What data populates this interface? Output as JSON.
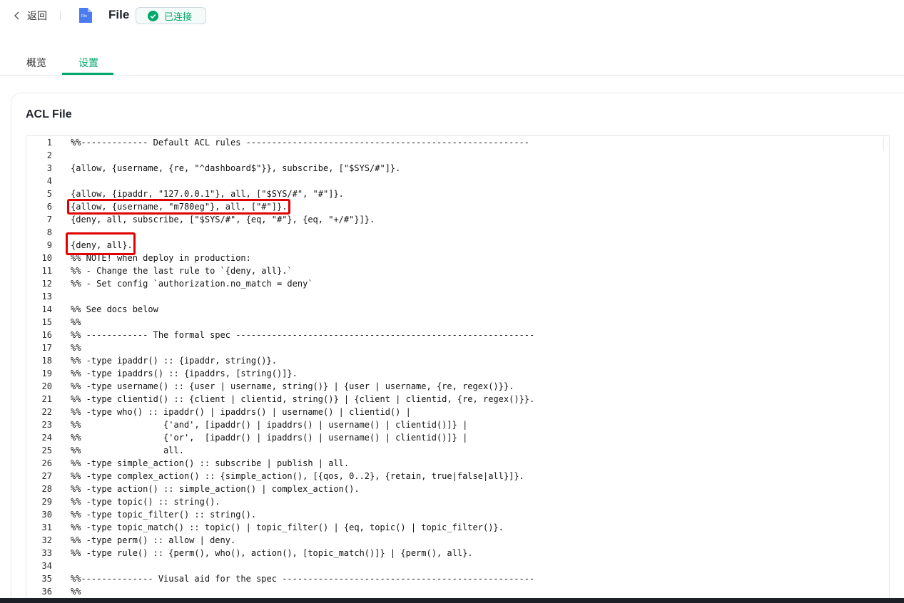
{
  "header": {
    "back_label": "返回",
    "title": "File",
    "status": "已连接",
    "file_icon_text": "File"
  },
  "tabs": [
    {
      "label": "概览",
      "active": false
    },
    {
      "label": "设置",
      "active": true
    }
  ],
  "card": {
    "title": "ACL File"
  },
  "editor": {
    "lines": [
      {
        "n": "1",
        "text": "%%------------- Default ACL rules -------------------------------------------------------"
      },
      {
        "n": "2",
        "text": ""
      },
      {
        "n": "3",
        "text": "{allow, {username, {re, \"^dashboard$\"}}, subscribe, [\"$SYS/#\"]}."
      },
      {
        "n": "4",
        "text": ""
      },
      {
        "n": "5",
        "text": "{allow, {ipaddr, \"127.0.0.1\"}, all, [\"$SYS/#\", \"#\"]}."
      },
      {
        "n": "6",
        "text": "{allow, {username, \"m780eg\"}, all, [\"#\"]}."
      },
      {
        "n": "7",
        "text": "{deny, all, subscribe, [\"$SYS/#\", {eq, \"#\"}, {eq, \"+/#\"}]}."
      },
      {
        "n": "8",
        "text": ""
      },
      {
        "n": "9",
        "text": "{deny, all}."
      },
      {
        "n": "10",
        "text": "%% NOTE! when deploy in production:"
      },
      {
        "n": "11",
        "text": "%% - Change the last rule to `{deny, all}.`"
      },
      {
        "n": "12",
        "text": "%% - Set config `authorization.no_match = deny`"
      },
      {
        "n": "13",
        "text": ""
      },
      {
        "n": "14",
        "text": "%% See docs below"
      },
      {
        "n": "15",
        "text": "%%"
      },
      {
        "n": "16",
        "text": "%% ------------ The formal spec ----------------------------------------------------------"
      },
      {
        "n": "17",
        "text": "%%"
      },
      {
        "n": "18",
        "text": "%% -type ipaddr() :: {ipaddr, string()}."
      },
      {
        "n": "19",
        "text": "%% -type ipaddrs() :: {ipaddrs, [string()]}."
      },
      {
        "n": "20",
        "text": "%% -type username() :: {user | username, string()} | {user | username, {re, regex()}}."
      },
      {
        "n": "21",
        "text": "%% -type clientid() :: {client | clientid, string()} | {client | clientid, {re, regex()}}."
      },
      {
        "n": "22",
        "text": "%% -type who() :: ipaddr() | ipaddrs() | username() | clientid() |"
      },
      {
        "n": "23",
        "text": "%%                {'and', [ipaddr() | ipaddrs() | username() | clientid()]} |"
      },
      {
        "n": "24",
        "text": "%%                {'or',  [ipaddr() | ipaddrs() | username() | clientid()]} |"
      },
      {
        "n": "25",
        "text": "%%                all."
      },
      {
        "n": "26",
        "text": "%% -type simple_action() :: subscribe | publish | all."
      },
      {
        "n": "27",
        "text": "%% -type complex_action() :: {simple_action(), [{qos, 0..2}, {retain, true|false|all}]}."
      },
      {
        "n": "28",
        "text": "%% -type action() :: simple_action() | complex_action()."
      },
      {
        "n": "29",
        "text": "%% -type topic() :: string()."
      },
      {
        "n": "30",
        "text": "%% -type topic_filter() :: string()."
      },
      {
        "n": "31",
        "text": "%% -type topic_match() :: topic() | topic_filter() | {eq, topic() | topic_filter()}."
      },
      {
        "n": "32",
        "text": "%% -type perm() :: allow | deny."
      },
      {
        "n": "33",
        "text": "%% -type rule() :: {perm(), who(), action(), [topic_match()]} | {perm(), all}."
      },
      {
        "n": "34",
        "text": ""
      },
      {
        "n": "35",
        "text": "%%-------------- Viusal aid for the spec -------------------------------------------------"
      },
      {
        "n": "36",
        "text": "%%"
      }
    ]
  },
  "colors": {
    "accent": "#00a86b",
    "highlight": "#e00000"
  },
  "icons": {
    "back": "chevron-left-icon",
    "file": "file-icon",
    "status": "check-circle-icon"
  }
}
